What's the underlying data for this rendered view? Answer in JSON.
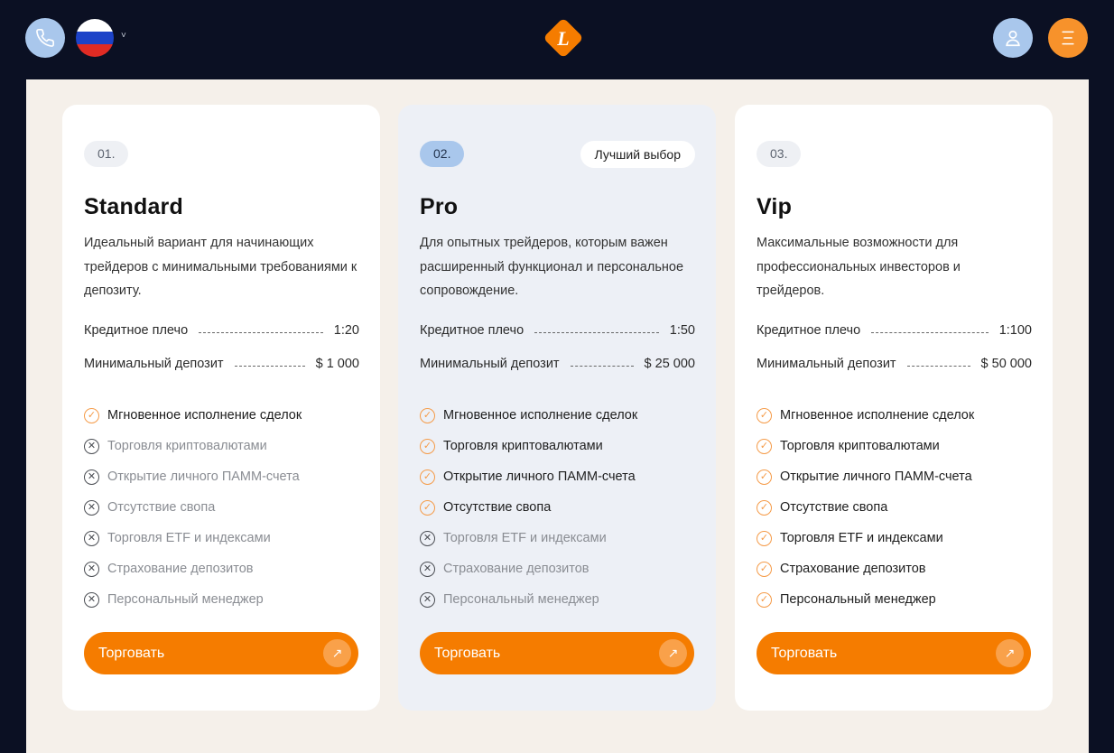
{
  "header": {
    "phone_icon": "phone-icon",
    "language": "RU",
    "language_chevron": "˅",
    "logo_letter": "L",
    "user_icon": "user-icon",
    "menu_icon": "menu-icon"
  },
  "colors": {
    "background": "#0b1023",
    "panel": "#f5f0ea",
    "accent": "#f57c00",
    "accent_light": "#f9a14a",
    "blue": "#a9c7ec"
  },
  "plans": [
    {
      "number": "01.",
      "title": "Standard",
      "description": "Идеальный вариант для начинающих трейдеров с минимальными требованиями к депозиту.",
      "leverage_label": "Кредитное плечо",
      "leverage_value": "1:20",
      "deposit_label": "Минимальный депозит",
      "deposit_value": "$ 1 000",
      "features": [
        {
          "label": "Мгновенное исполнение сделок",
          "included": true
        },
        {
          "label": "Торговля криптовалютами",
          "included": false
        },
        {
          "label": "Открытие личного ПАММ-счета",
          "included": false
        },
        {
          "label": "Отсутствие свопа",
          "included": false
        },
        {
          "label": "Торговля ETF и индексами",
          "included": false
        },
        {
          "label": "Страхование депозитов",
          "included": false
        },
        {
          "label": "Персональный менеджер",
          "included": false
        }
      ],
      "button": "Торговать"
    },
    {
      "number": "02.",
      "badge": "Лучший выбор",
      "title": "Pro",
      "description": "Для опытных трейдеров, которым важен расширенный функционал и персональное сопровождение.",
      "leverage_label": "Кредитное плечо",
      "leverage_value": "1:50",
      "deposit_label": "Минимальный депозит",
      "deposit_value": "$ 25 000",
      "features": [
        {
          "label": "Мгновенное исполнение сделок",
          "included": true
        },
        {
          "label": "Торговля криптовалютами",
          "included": true
        },
        {
          "label": "Открытие личного ПАММ-счета",
          "included": true
        },
        {
          "label": "Отсутствие свопа",
          "included": true
        },
        {
          "label": "Торговля ETF и индексами",
          "included": false
        },
        {
          "label": "Страхование депозитов",
          "included": false
        },
        {
          "label": "Персональный менеджер",
          "included": false
        }
      ],
      "button": "Торговать"
    },
    {
      "number": "03.",
      "title": "Vip",
      "description": "Максимальные возможности для профессиональных инвесторов и трейдеров.",
      "leverage_label": "Кредитное плечо",
      "leverage_value": "1:100",
      "deposit_label": "Минимальный депозит",
      "deposit_value": "$ 50 000",
      "features": [
        {
          "label": "Мгновенное исполнение сделок",
          "included": true
        },
        {
          "label": "Торговля криптовалютами",
          "included": true
        },
        {
          "label": "Открытие личного ПАММ-счета",
          "included": true
        },
        {
          "label": "Отсутствие свопа",
          "included": true
        },
        {
          "label": "Торговля ETF и индексами",
          "included": true
        },
        {
          "label": "Страхование депозитов",
          "included": true
        },
        {
          "label": "Персональный менеджер",
          "included": true
        }
      ],
      "button": "Торговать"
    }
  ]
}
